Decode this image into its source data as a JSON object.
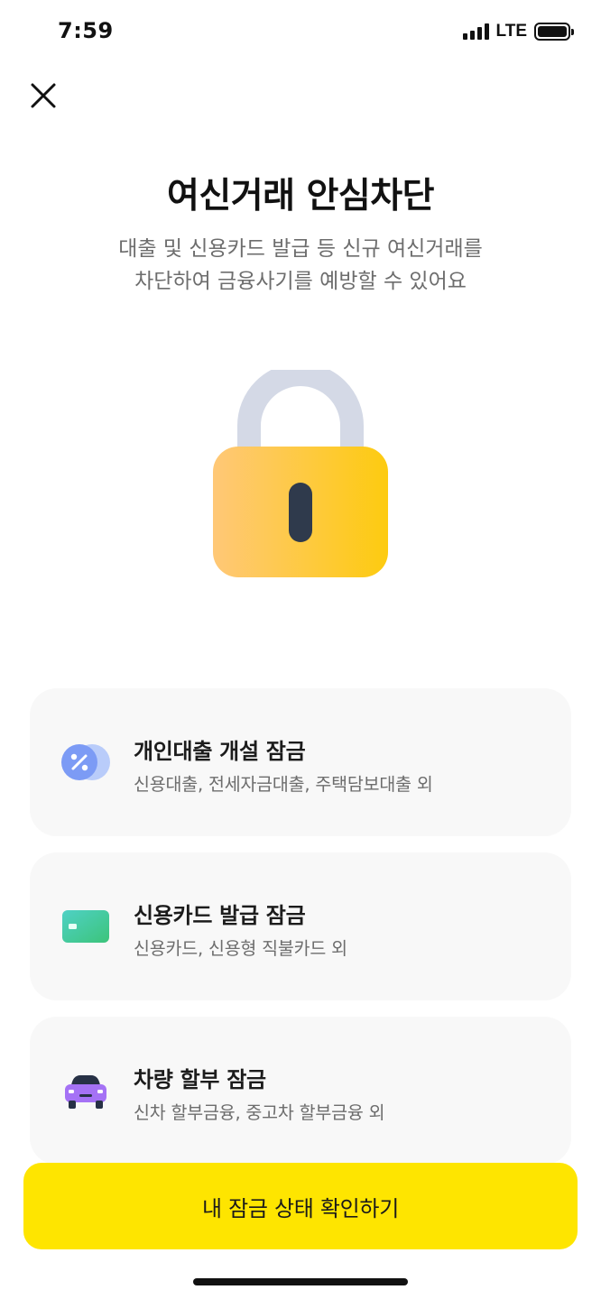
{
  "status_bar": {
    "time": "7:59",
    "network": "LTE",
    "signal_icon": "signal-bars-icon",
    "battery_icon": "battery-icon",
    "battery_level": 1.0
  },
  "header": {
    "close_icon": "close-icon",
    "title": "여신거래 안심차단",
    "description_line1": "대출 및 신용카드 발급 등 신규 여신거래를",
    "description_line2": "차단하여 금융사기를 예방할 수 있어요"
  },
  "hero": {
    "icon": "padlock-icon",
    "colors": {
      "shackle": "#d4d9e6",
      "body_start": "#ffc877",
      "body_end": "#fdcb10",
      "keyhole": "#2f3a4c"
    }
  },
  "items": [
    {
      "icon": "percent-coin-icon",
      "title": "개인대출 개설 잠금",
      "subtitle": "신용대출, 전세자금대출, 주택담보대출 외"
    },
    {
      "icon": "credit-card-icon",
      "title": "신용카드 발급 잠금",
      "subtitle": "신용카드, 신용형 직불카드 외"
    },
    {
      "icon": "car-icon",
      "title": "차량 할부 잠금",
      "subtitle": "신차 할부금융, 중고차 할부금융 외"
    }
  ],
  "cta": {
    "label": "내 잠금 상태 확인하기",
    "color": "#fee500"
  }
}
